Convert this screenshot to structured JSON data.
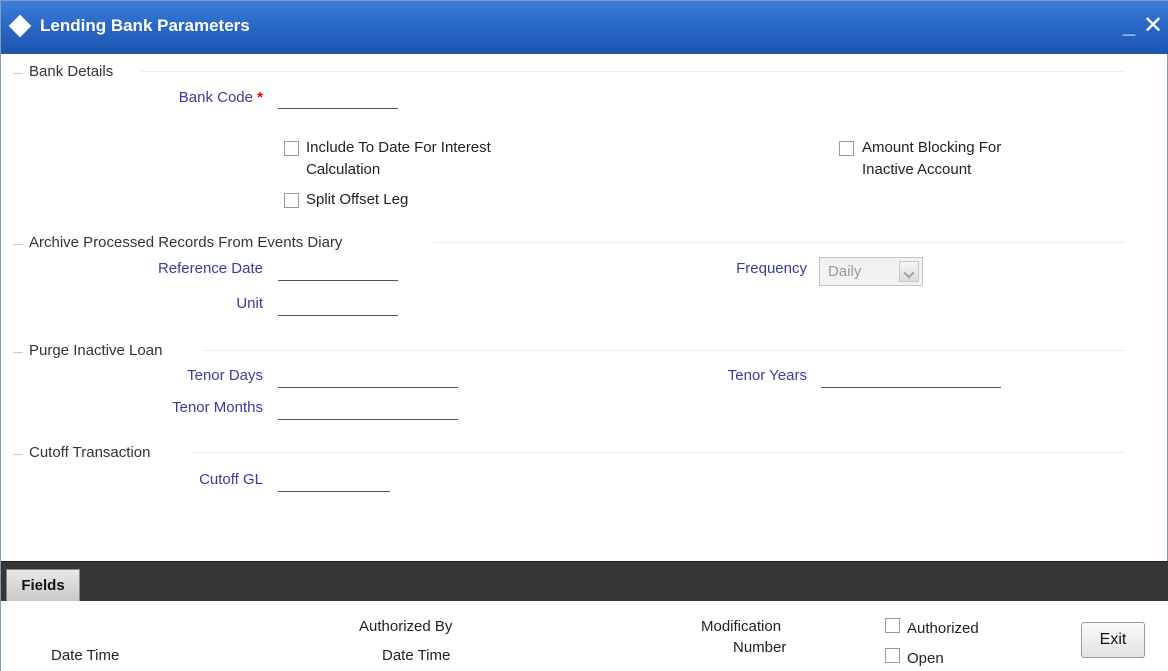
{
  "window": {
    "title": "Lending Bank Parameters",
    "minimize_label": "_",
    "close_label": "✕"
  },
  "bank_details": {
    "title": "Bank Details",
    "bank_code_label": "Bank Code",
    "bank_code_value": "",
    "required_mark": "*",
    "include_to_date_line1": "Include To Date For Interest",
    "include_to_date_line2": "Calculation",
    "split_offset_leg": "Split Offset Leg",
    "amount_blocking_line1": "Amount Blocking For",
    "amount_blocking_line2": "Inactive Account"
  },
  "archive": {
    "title": "Archive Processed Records From Events Diary",
    "reference_date_label": "Reference Date",
    "reference_date_value": "",
    "unit_label": "Unit",
    "unit_value": "",
    "frequency_label": "Frequency",
    "frequency_value": "Daily"
  },
  "purge": {
    "title": "Purge Inactive Loan",
    "tenor_days_label": "Tenor Days",
    "tenor_days_value": "",
    "tenor_months_label": "Tenor Months",
    "tenor_months_value": "",
    "tenor_years_label": "Tenor Years",
    "tenor_years_value": ""
  },
  "cutoff": {
    "title": "Cutoff Transaction",
    "cutoff_gl_label": "Cutoff GL",
    "cutoff_gl_value": ""
  },
  "footer": {
    "fields_tab": "Fields",
    "date_time_1": "Date Time",
    "authorized_by": "Authorized By",
    "date_time_2": "Date Time",
    "modification_line1": "Modification",
    "modification_line2": "Number",
    "authorized": "Authorized",
    "open": "Open",
    "exit_label": "Exit"
  },
  "colors": {
    "title_bar": "#2a68c6",
    "field_label": "#3b3b9e",
    "required": "#e00000",
    "footer_bar": "#363636"
  }
}
